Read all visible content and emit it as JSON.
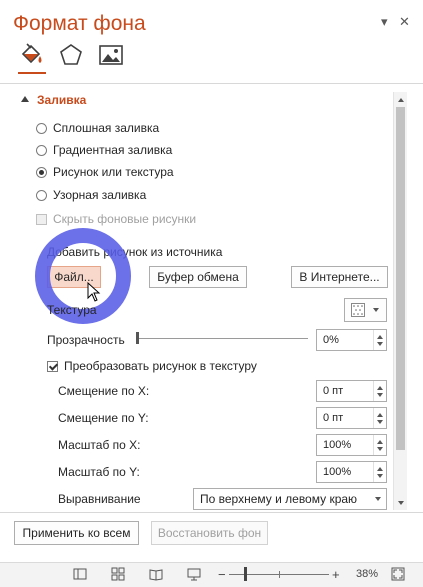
{
  "pane": {
    "title": "Формат фона",
    "menu_glyph": "▾",
    "close_glyph": "✕"
  },
  "tabs": [
    {
      "name": "fill-bucket-icon",
      "active": true
    },
    {
      "name": "pentagon-effects-icon",
      "active": false
    },
    {
      "name": "picture-icon",
      "active": false
    }
  ],
  "fill": {
    "section_title": "Заливка",
    "options": [
      {
        "label": "Сплошная заливка",
        "checked": false
      },
      {
        "label": "Градиентная заливка",
        "checked": false
      },
      {
        "label": "Рисунок или текстура",
        "checked": true
      },
      {
        "label": "Узорная заливка",
        "checked": false
      }
    ],
    "hide_bg_label": "Скрыть фоновые рисунки",
    "insert_from_label": "Добавить рисунок из источника",
    "file_button": "Файл...",
    "clipboard_button": "Буфер обмена",
    "online_button": "В Интернете...",
    "texture_label": "Текстура",
    "transparency_label": "Прозрачность",
    "transparency_value": "0%",
    "transparency_fraction": 0,
    "tile_label": "Преобразовать рисунок в текстуру",
    "tile_checked": true,
    "offset_x_label": "Смещение по X:",
    "offset_x_value": "0 пт",
    "offset_y_label": "Смещение по Y:",
    "offset_y_value": "0 пт",
    "scale_x_label": "Масштаб по X:",
    "scale_x_value": "100%",
    "scale_y_label": "Масштаб по Y:",
    "scale_y_value": "100%",
    "alignment_label": "Выравнивание",
    "alignment_value": "По верхнему и левому краю"
  },
  "footer": {
    "apply_all": "Применить ко всем",
    "reset_bg": "Восстановить фон"
  },
  "status": {
    "zoom_minus": "−",
    "zoom_plus": "+",
    "zoom_value": "38%",
    "zoom_fraction": 0.38
  },
  "colors": {
    "accent": "#c84b1c",
    "highlight_ring": "#585ce6",
    "pressed_button": "#f9d8cc"
  }
}
